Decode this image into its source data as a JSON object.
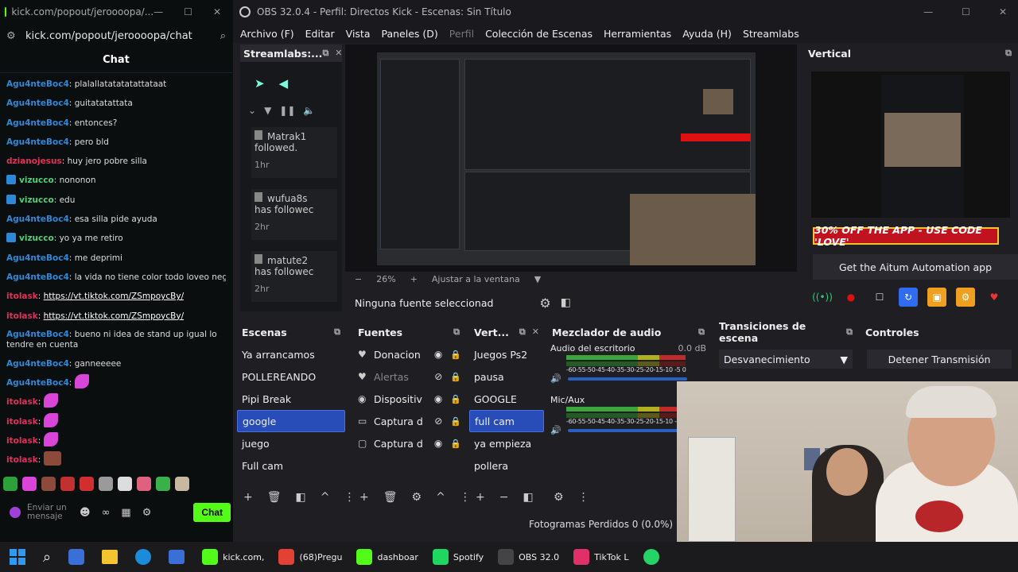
{
  "chat_window": {
    "title": "kick.com/popout/jeroooopa/...",
    "url": "kick.com/popout/jeroooopa/chat",
    "header": "Chat",
    "messages": [
      {
        "user": "Agu4nteBoc4",
        "color": "#2e88d8",
        "text": "plalallatatatatattataat"
      },
      {
        "user": "Agu4nteBoc4",
        "color": "#2e88d8",
        "text": "guitatatattata"
      },
      {
        "user": "Agu4nteBoc4",
        "color": "#2e88d8",
        "text": "entonces?"
      },
      {
        "user": "Agu4nteBoc4",
        "color": "#2e88d8",
        "text": "pero bld"
      },
      {
        "user": "dzianojesus",
        "color": "#e0325a",
        "text": "huy jero pobre silla"
      },
      {
        "user": "vizucco",
        "color": "#4fd17a",
        "text": "nononon",
        "badge": true
      },
      {
        "user": "vizucco",
        "color": "#4fd17a",
        "text": "edu",
        "badge": true
      },
      {
        "user": "Agu4nteBoc4",
        "color": "#2e88d8",
        "text": "esa silla pide ayuda"
      },
      {
        "user": "vizucco",
        "color": "#4fd17a",
        "text": "yo ya me retiro",
        "badge": true
      },
      {
        "user": "Agu4nteBoc4",
        "color": "#2e88d8",
        "text": "me deprimi"
      },
      {
        "user": "Agu4nteBoc4",
        "color": "#2e88d8",
        "text": "la vida no tiene color todo loveo negro"
      },
      {
        "user": "itolask",
        "color": "#e0325a",
        "text": "https://vt.tiktok.com/ZSmpoycBy/",
        "link": true
      },
      {
        "user": "itolask",
        "color": "#e0325a",
        "text": "https://vt.tiktok.com/ZSmpoycBy/",
        "link": true
      },
      {
        "user": "Agu4nteBoc4",
        "color": "#2e88d8",
        "text": "bueno ni idea de stand up igual lo tendre en cuenta",
        "wrap": true
      },
      {
        "user": "Agu4nteBoc4",
        "color": "#2e88d8",
        "text": "ganneeeee"
      },
      {
        "user": "Agu4nteBoc4",
        "color": "#2e88d8",
        "text": "",
        "emote": true
      },
      {
        "user": "itolask",
        "color": "#e0325a",
        "text": "",
        "emote": true
      },
      {
        "user": "itolask",
        "color": "#e0325a",
        "text": "",
        "emote": true
      },
      {
        "user": "itolask",
        "color": "#e0325a",
        "text": "",
        "emote": true
      },
      {
        "user": "itolask",
        "color": "#e0325a",
        "text": "",
        "emote_pic": true
      }
    ],
    "composer_placeholder": "Enviar un mensaje",
    "send_label": "Chat"
  },
  "obs": {
    "title": "OBS 32.0.4 - Perfil: Directos Kick - Escenas: Sin Título",
    "menu": [
      "Archivo (F)",
      "Editar",
      "Vista",
      "Paneles (D)",
      "Perfil",
      "Colección de Escenas",
      "Herramientas",
      "Ayuda (H)",
      "Streamlabs"
    ],
    "streamlabs_title": "Streamlabs:...",
    "events": [
      {
        "name": "Matrak1",
        "action": "followed.",
        "time": "1hr"
      },
      {
        "name": "wufua8s",
        "action": "has followec",
        "time": "2hr"
      },
      {
        "name": "matute2",
        "action": "has followec",
        "time": "2hr"
      }
    ],
    "zoom": "26%",
    "fit_label": "Ajustar a la ventana",
    "no_source": "Ninguna fuente seleccionad",
    "vertical_title": "Vertical",
    "promo": "30% OFF THE APP - USE CODE 'LOVE'",
    "aitum": "Get the Aitum Automation app",
    "scenes_title": "Escenas",
    "scenes": [
      "Ya arrancamos",
      "POLLEREANDO",
      "Pipi Break",
      "google",
      "juego",
      "Full cam"
    ],
    "selected_scene": 3,
    "sources_title": "Fuentes",
    "sources": [
      "Donacion",
      "Alertas",
      "Dispositiv",
      "Captura d",
      "Captura d"
    ],
    "vert_title": "Vert...",
    "vert_scenes": [
      "Juegos Ps2",
      "pausa",
      "GOOGLE",
      "full cam",
      "ya empieza",
      "pollera"
    ],
    "selected_vert": 3,
    "mixer_title": "Mezclador de audio",
    "tracks": [
      {
        "name": "Audio del escritorio",
        "db": "0.0 dB"
      },
      {
        "name": "Mic/Aux",
        "db": ""
      }
    ],
    "scale": "-60-55-50-45-40-35-30-25-20-15-10 -5 0",
    "transitions_title": "Transiciones de escena",
    "transition": "Desvanecimiento",
    "controls_title": "Controles",
    "stop_stream": "Detener Transmisión",
    "status": "Fotogramas Perdidos 0 (0.0%)"
  },
  "taskbar": [
    {
      "label": "kick.com,",
      "icon": "kick-icon",
      "color": "#53fc18"
    },
    {
      "label": "(68)Pregu",
      "icon": "chrome-icon",
      "color": "#e34133"
    },
    {
      "label": "dashboar",
      "icon": "kick-icon",
      "color": "#53fc18"
    },
    {
      "label": "Spotify",
      "icon": "spotify-icon",
      "color": "#1ed760"
    },
    {
      "label": "OBS 32.0",
      "icon": "obs-icon",
      "color": "#444"
    },
    {
      "label": "TikTok L",
      "icon": "tiktok-icon",
      "color": "#e0306a"
    }
  ]
}
